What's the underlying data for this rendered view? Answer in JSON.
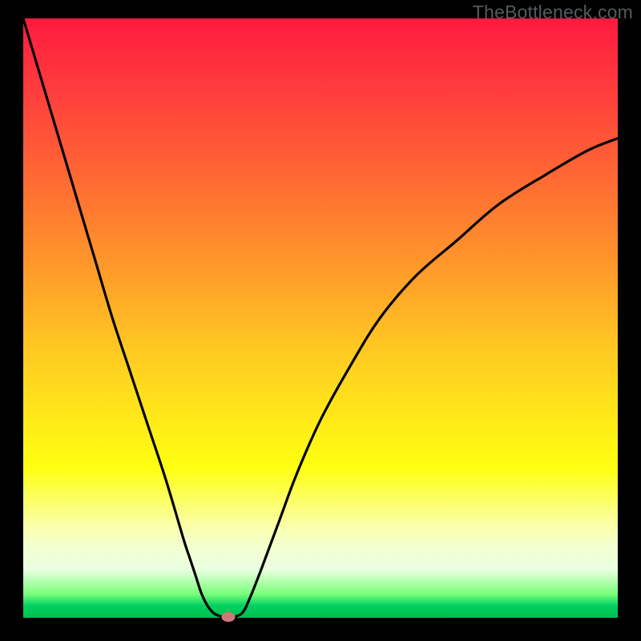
{
  "watermark": "TheBottleneck.com",
  "chart_data": {
    "type": "line",
    "title": "",
    "xlabel": "",
    "ylabel": "",
    "xlim": [
      0,
      100
    ],
    "ylim": [
      0,
      100
    ],
    "series": [
      {
        "name": "bottleneck-curve",
        "x": [
          0,
          3,
          6,
          9,
          12,
          15,
          18,
          21,
          24,
          27,
          28,
          29,
          30,
          31,
          32,
          33,
          34,
          35,
          36,
          37,
          38,
          40,
          43,
          46,
          50,
          55,
          60,
          66,
          73,
          80,
          88,
          95,
          100
        ],
        "values": [
          100,
          90,
          80,
          70,
          60,
          50,
          41,
          32,
          23,
          13,
          10,
          7,
          4,
          2,
          0.8,
          0.3,
          0.1,
          0.1,
          0.3,
          1,
          3,
          8,
          16,
          24,
          33,
          42,
          50,
          57,
          63,
          69,
          74,
          78,
          80
        ]
      }
    ],
    "marker": {
      "x": 34.5,
      "y": 0.2
    },
    "gradient_stops": [
      {
        "pos": 0,
        "color": "#ff1a3f"
      },
      {
        "pos": 12,
        "color": "#ff3d3d"
      },
      {
        "pos": 27,
        "color": "#ff6a33"
      },
      {
        "pos": 40,
        "color": "#ff942b"
      },
      {
        "pos": 55,
        "color": "#ffc822"
      },
      {
        "pos": 65,
        "color": "#ffe41a"
      },
      {
        "pos": 75,
        "color": "#ffff11"
      },
      {
        "pos": 84,
        "color": "#faffa0"
      },
      {
        "pos": 88,
        "color": "#f5ffd0"
      },
      {
        "pos": 92,
        "color": "#e8ffe0"
      },
      {
        "pos": 96,
        "color": "#7bff7b"
      },
      {
        "pos": 98,
        "color": "#00d060"
      },
      {
        "pos": 100,
        "color": "#00c050"
      }
    ]
  }
}
